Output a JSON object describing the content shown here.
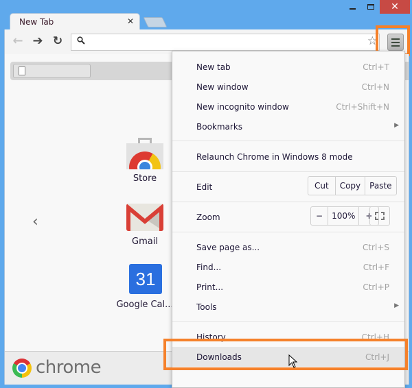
{
  "window": {
    "controls": {
      "minimize": "minimize",
      "maximize": "maximize",
      "close": "✕"
    }
  },
  "tabs": [
    {
      "title": "New Tab",
      "close": "✕"
    }
  ],
  "toolbar": {
    "back": "←",
    "forward": "➔",
    "reload": "↻",
    "omnibox_value": "",
    "search_icon": "⚲",
    "star_icon": "☆"
  },
  "page": {
    "bookmark_item": "",
    "chevron": "‹",
    "apps": [
      {
        "name": "Store",
        "icon": "chrome-web-store-icon"
      },
      {
        "name": "Gmail",
        "icon": "gmail-icon"
      },
      {
        "name": "Google Cal...",
        "icon": "google-calendar-icon",
        "icon_text": "31"
      }
    ],
    "footer_brand": "chrome"
  },
  "menu": {
    "items": [
      {
        "label": "New tab",
        "shortcut": "Ctrl+T"
      },
      {
        "label": "New window",
        "shortcut": "Ctrl+N"
      },
      {
        "label": "New incognito window",
        "shortcut": "Ctrl+Shift+N"
      },
      {
        "label": "Bookmarks",
        "submenu": "▶"
      },
      {
        "label": "Relaunch Chrome in Windows 8 mode"
      },
      {
        "label": "Edit",
        "buttons": [
          "Cut",
          "Copy",
          "Paste"
        ]
      },
      {
        "label": "Zoom",
        "buttons": [
          "−",
          "100%",
          "+"
        ]
      },
      {
        "label": "Save page as...",
        "shortcut": "Ctrl+S"
      },
      {
        "label": "Find...",
        "shortcut": "Ctrl+F"
      },
      {
        "label": "Print...",
        "shortcut": "Ctrl+P"
      },
      {
        "label": "Tools",
        "submenu": "▶"
      },
      {
        "label": "History",
        "shortcut": "Ctrl+H"
      },
      {
        "label": "Downloads",
        "shortcut": "Ctrl+J",
        "highlighted": true
      }
    ]
  },
  "colors": {
    "highlight": "#f5812b",
    "titlebar": "#5fa9ec",
    "close": "#c74a44"
  }
}
